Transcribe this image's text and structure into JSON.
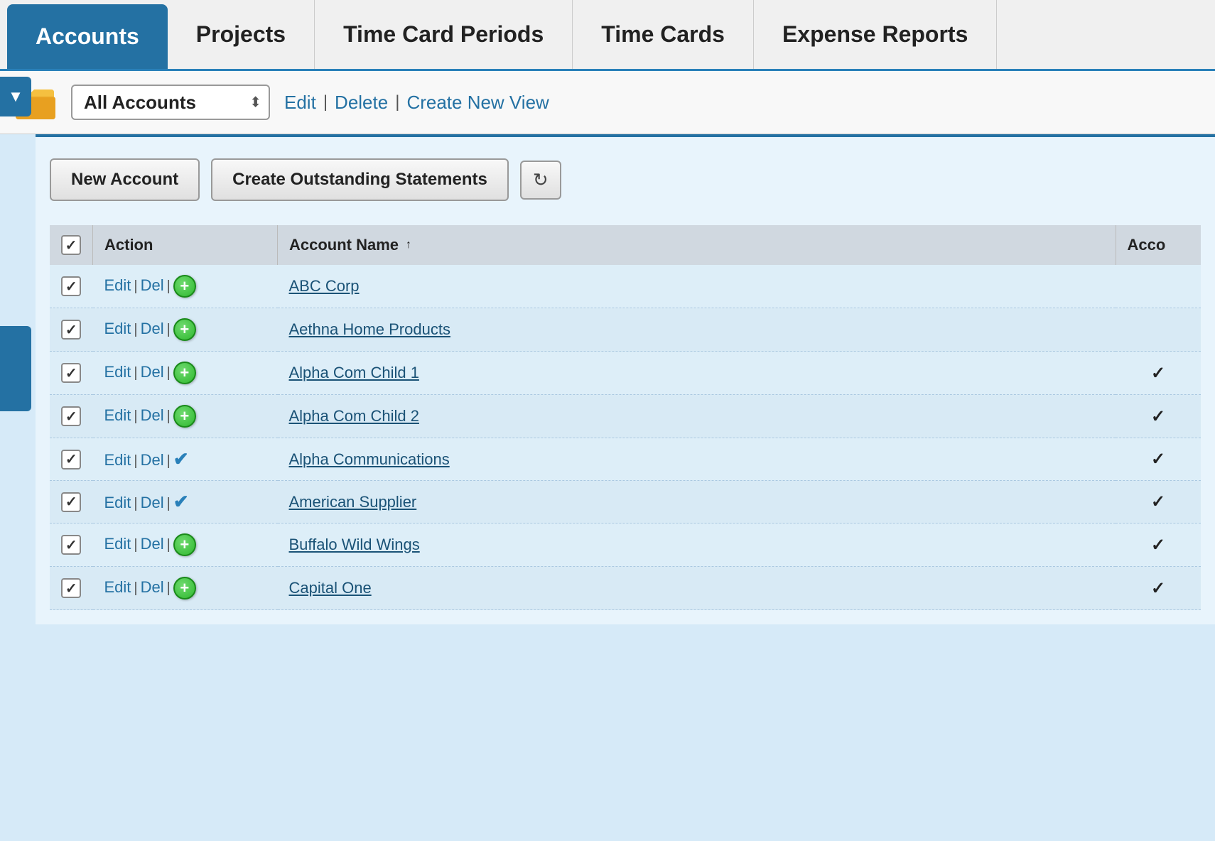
{
  "nav": {
    "items": [
      {
        "id": "accounts",
        "label": "Accounts",
        "active": true
      },
      {
        "id": "projects",
        "label": "Projects",
        "active": false
      },
      {
        "id": "timecardperiods",
        "label": "Time Card Periods",
        "active": false
      },
      {
        "id": "timecards",
        "label": "Time Cards",
        "active": false
      },
      {
        "id": "expensereports",
        "label": "Expense Reports",
        "active": false
      }
    ]
  },
  "toolbar": {
    "view_label": "All Accounts",
    "edit_label": "Edit",
    "delete_label": "Delete",
    "create_view_label": "Create New View"
  },
  "actions": {
    "new_account_label": "New Account",
    "create_statements_label": "Create Outstanding Statements",
    "refresh_icon": "↻"
  },
  "table": {
    "columns": [
      {
        "id": "checkbox",
        "label": ""
      },
      {
        "id": "action",
        "label": "Action"
      },
      {
        "id": "account_name",
        "label": "Account Name",
        "sortable": true
      },
      {
        "id": "acco",
        "label": "Acco"
      }
    ],
    "rows": [
      {
        "checked": true,
        "account_name": "ABC Corp",
        "icon": "plus",
        "acco": ""
      },
      {
        "checked": true,
        "account_name": "Aethna Home Products",
        "icon": "plus",
        "acco": ""
      },
      {
        "checked": true,
        "account_name": "Alpha Com Child 1",
        "icon": "plus",
        "acco": "✓"
      },
      {
        "checked": true,
        "account_name": "Alpha Com Child 2",
        "icon": "plus",
        "acco": "✓"
      },
      {
        "checked": true,
        "account_name": "Alpha Communications",
        "icon": "check",
        "acco": "✓"
      },
      {
        "checked": true,
        "account_name": "American Supplier",
        "icon": "check",
        "acco": "✓"
      },
      {
        "checked": true,
        "account_name": "Buffalo Wild Wings",
        "icon": "plus",
        "acco": "✓"
      },
      {
        "checked": true,
        "account_name": "Capital One",
        "icon": "plus",
        "acco": "✓"
      }
    ],
    "edit_label": "Edit",
    "del_label": "Del"
  },
  "sidebar_toggle_label": "▼",
  "colors": {
    "nav_active_bg": "#2471a3",
    "link_color": "#2471a3",
    "table_header_bg": "#c8d4de"
  }
}
